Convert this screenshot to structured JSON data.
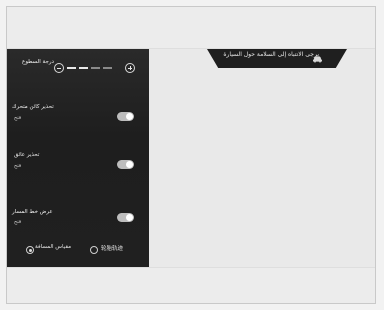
{
  "warning": {
    "text": "يرجى الانتباه إلى السلامة حول السيارة"
  },
  "settings": {
    "level_label": "درجة السطوع",
    "level_value": 0.4,
    "items": [
      {
        "title": "تحذير كائن متحرك",
        "status": "فتح",
        "enabled": true
      },
      {
        "title": "تحذير عائق",
        "status": "فتح",
        "enabled": true
      },
      {
        "title": "عرض خط المسار",
        "status": "فتح",
        "enabled": true
      }
    ]
  },
  "bottom": {
    "options": [
      {
        "label": "مقياس المسافة",
        "selected": true
      },
      {
        "label": "轮胎轨迹",
        "selected": false
      }
    ]
  }
}
